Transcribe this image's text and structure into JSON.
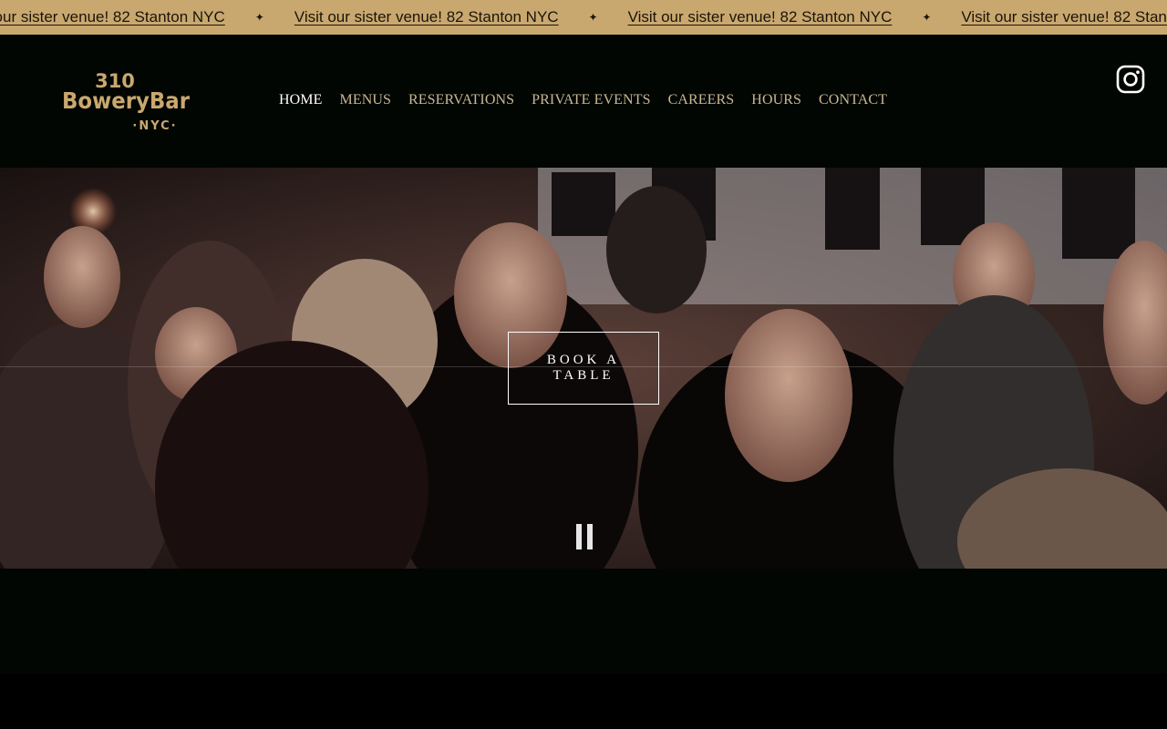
{
  "announcement": {
    "items": [
      "Visit our sister venue! 82 Stanton NYC",
      "Visit our sister venue! 82 Stanton NYC",
      "Visit our sister venue! 82 Stanton NYC",
      "Visit our sister venue! 82 Stanton NYC"
    ],
    "separator": "✦"
  },
  "logo": {
    "line1": "310",
    "line2": "BoweryBar",
    "line3": "·NYC·"
  },
  "nav": {
    "items": [
      {
        "label": "HOME",
        "active": true
      },
      {
        "label": "MENUS",
        "active": false
      },
      {
        "label": "RESERVATIONS",
        "active": false
      },
      {
        "label": "PRIVATE EVENTS",
        "active": false
      },
      {
        "label": "CAREERS",
        "active": false
      },
      {
        "label": "HOURS",
        "active": false
      },
      {
        "label": "CONTACT",
        "active": false
      }
    ]
  },
  "social": {
    "icon": "instagram-icon"
  },
  "hero": {
    "cta_label": "BOOK A TABLE",
    "video_control_icon": "pause-icon"
  },
  "colors": {
    "gold": "#c9a86f",
    "nav_text": "#c9b894",
    "header_bg": "#020603"
  }
}
